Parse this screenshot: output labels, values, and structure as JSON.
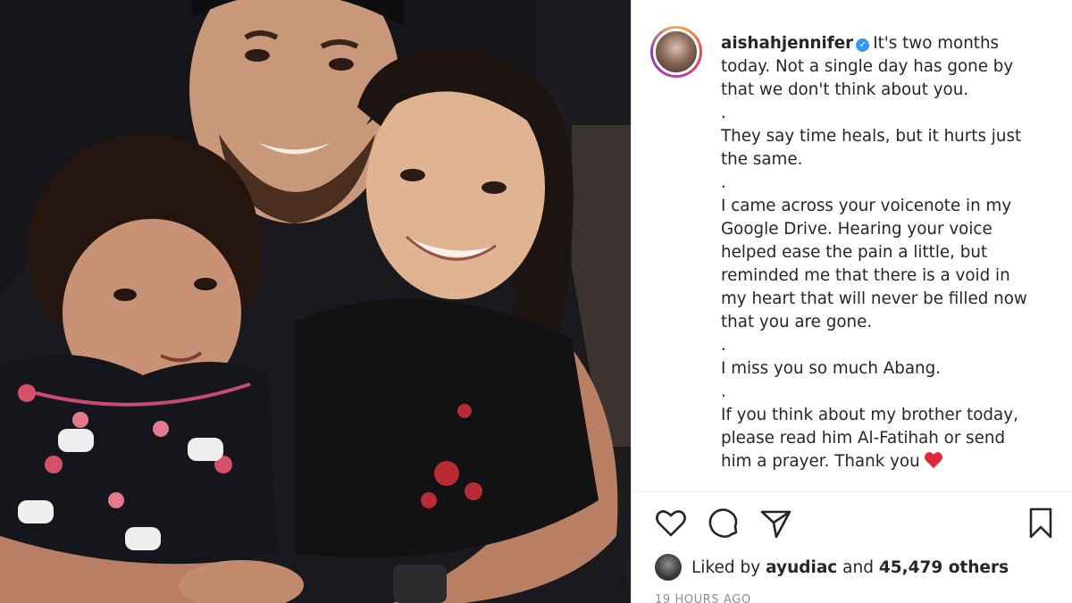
{
  "post": {
    "username": "aishahjennifer",
    "verified_icon": "verified-badge-icon",
    "caption_lines": [
      "It's two months today. Not a single day has gone by that we don't think about you.",
      ".",
      "They say time heals, but it hurts just the same.",
      ".",
      "I came across your voicenote in my Google Drive. Hearing your voice helped ease the pain a little, but reminded me that there is a void in my heart that will never be filled now that you are gone.",
      ".",
      "I miss you so much Abang.",
      ".",
      "If you think about my brother today, please read him Al-Fatihah or send him a prayer. Thank you"
    ],
    "caption_emoji": "red-heart-emoji"
  },
  "actions": {
    "like_icon": "heart-outline-icon",
    "comment_icon": "comment-icon",
    "share_icon": "paper-plane-icon",
    "save_icon": "bookmark-icon"
  },
  "likes": {
    "prefix": "Liked by",
    "user": "ayudiac",
    "joiner": "and",
    "count": "45,479 others"
  },
  "timestamp": "19 HOURS AGO",
  "colors": {
    "text": "#262626",
    "secondary": "#8e8e8e",
    "verified": "#3897f0",
    "heart": "#ed4956"
  }
}
